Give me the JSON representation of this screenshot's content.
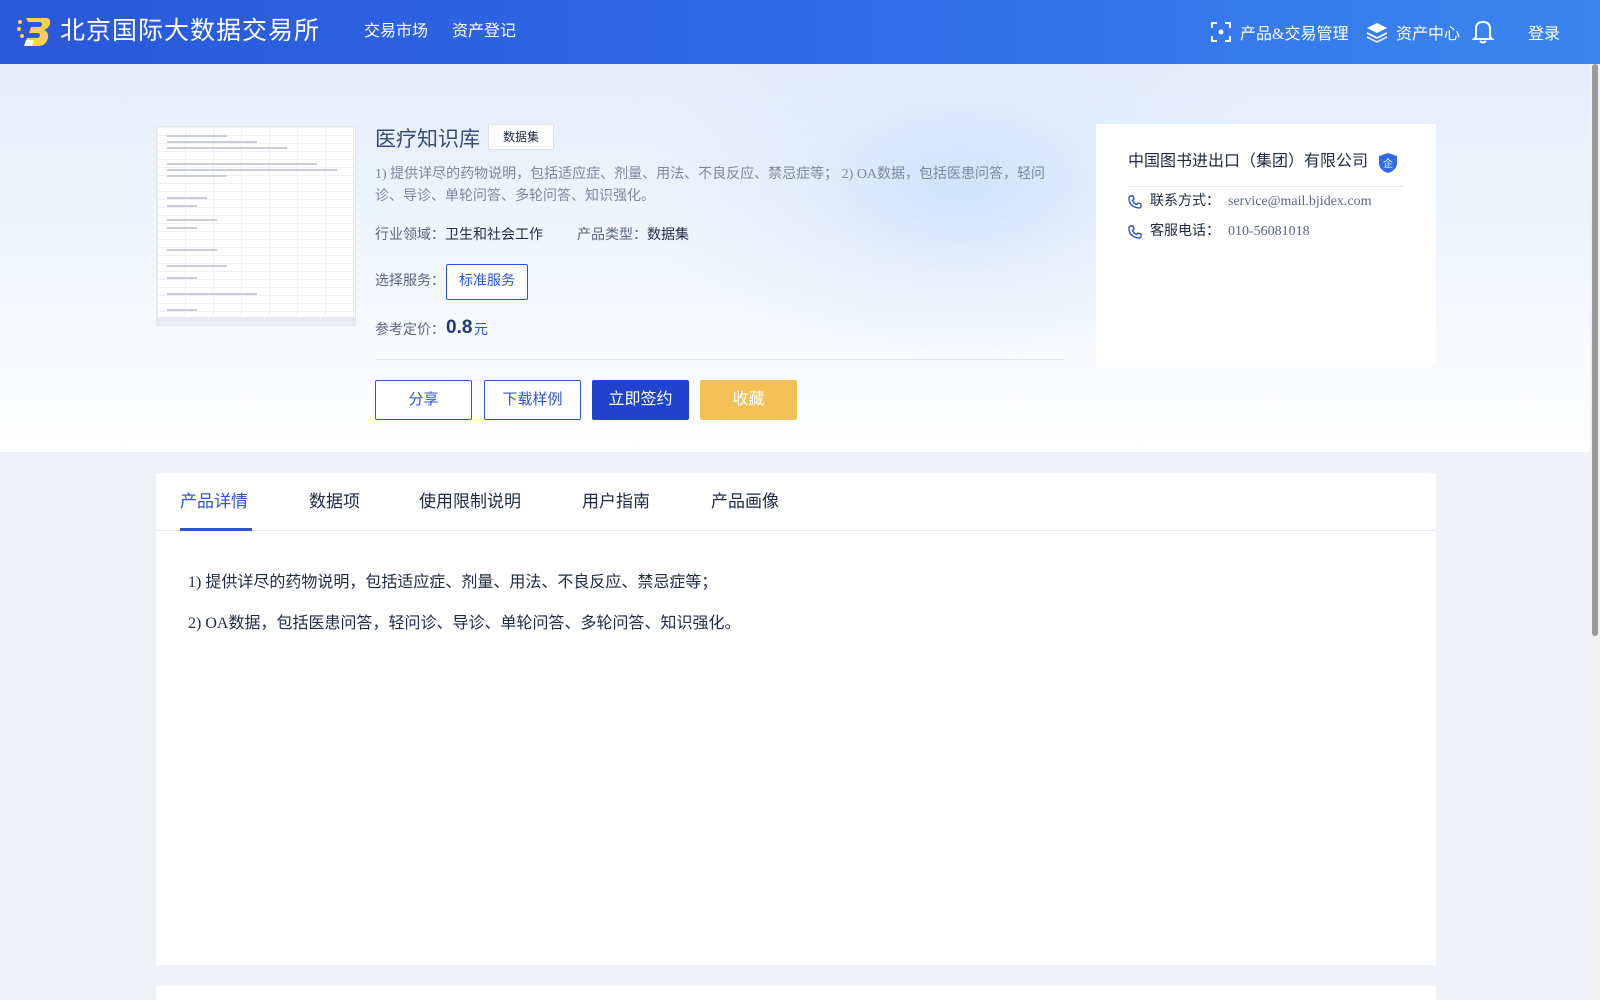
{
  "header": {
    "site_title": "北京国际大数据交易所",
    "nav": [
      "交易市场",
      "资产登记"
    ],
    "product_mgmt": "产品&交易管理",
    "asset_center": "资产中心",
    "login": "登录"
  },
  "product": {
    "title": "医疗知识库",
    "tag": "数据集",
    "description": "1) 提供详尽的药物说明，包括适应症、剂量、用法、不良反应、禁忌症等； 2) OA数据，包括医患问答，轻问诊、导诊、单轮问答、多轮问答、知识强化。",
    "industry_label": "行业领域：",
    "industry_value": "卫生和社会工作",
    "type_label": "产品类型：",
    "type_value": "数据集",
    "service_label": "选择服务：",
    "service_option": "标准服务",
    "price_label": "参考定价：",
    "price_value": "0.8",
    "price_unit": "元"
  },
  "actions": {
    "share": "分享",
    "download_sample": "下载样例",
    "sign_now": "立即签约",
    "favorite": "收藏"
  },
  "company": {
    "name": "中国图书进出口（集团）有限公司",
    "badge_text": "企",
    "contact_label": "联系方式：",
    "contact_value": "service@mail.bjidex.com",
    "phone_label": "客服电话：",
    "phone_value": "010-56081018"
  },
  "tabs": [
    "产品详情",
    "数据项",
    "使用限制说明",
    "用户指南",
    "产品画像"
  ],
  "details": [
    "1)  提供详尽的药物说明，包括适应症、剂量、用法、不良反应、禁忌症等；",
    "2)  OA数据，包括医患问答，轻问诊、导诊、单轮问答、多轮问答、知识强化。"
  ],
  "colors": {
    "primary": "#2d54d6",
    "header_start": "#2a58d8",
    "header_end": "#3c86f0",
    "favorite": "#f4c156"
  }
}
